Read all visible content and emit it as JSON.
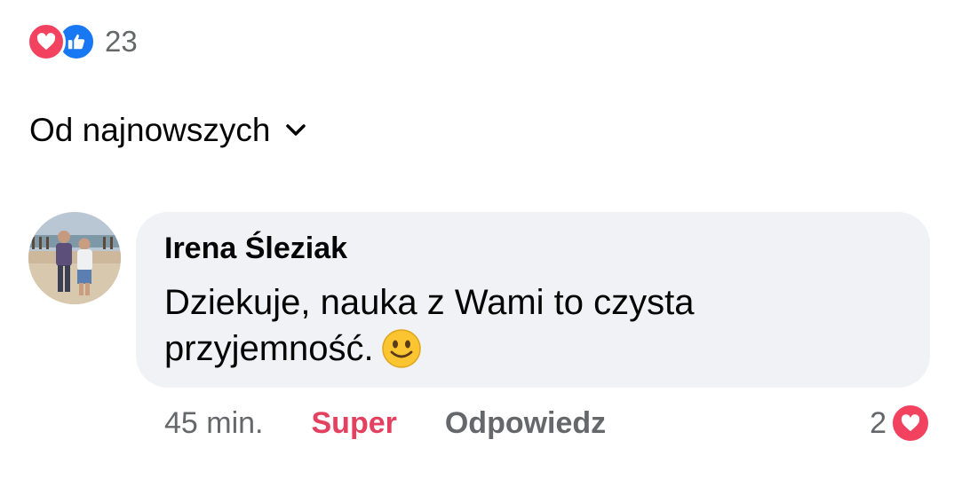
{
  "post_reactions": {
    "icons": [
      "heart-icon",
      "thumbs-up-icon"
    ],
    "count": "23"
  },
  "sort": {
    "label": "Od najnowszych",
    "icon": "chevron-down-icon"
  },
  "comment": {
    "author": "Irena Śleziak",
    "text": "Dziekuje, nauka z Wami to czysta przyjemność.",
    "emoji": "slightly-smiling-face-emoji",
    "time": "45 min.",
    "reaction_label": "Super",
    "reply_label": "Odpowiedz",
    "reaction_count": "2"
  },
  "colors": {
    "love": "#f3425f",
    "like": "#1877f2",
    "super_text": "#e4405f",
    "secondary_text": "#65676b",
    "bubble_bg": "#f0f2f5"
  }
}
